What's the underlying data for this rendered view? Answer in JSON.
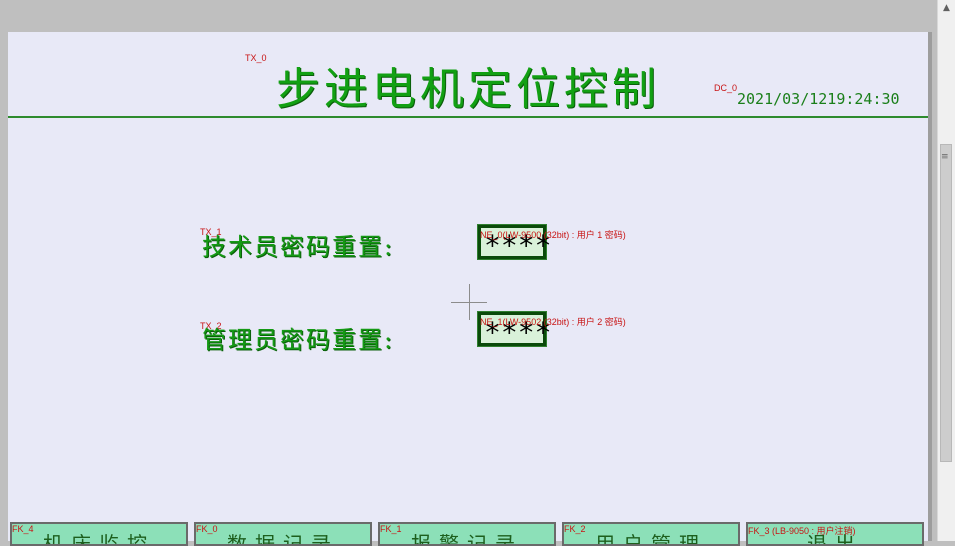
{
  "header": {
    "title": "步进电机定位控制",
    "title_tag": "TX_0",
    "datetime_tag": "DC_0",
    "datetime": "2021/03/1219:24:30"
  },
  "form": {
    "rows": [
      {
        "tag": "TX_1",
        "label": "技术员密码重置:",
        "field_tag": "NE_0(LW-9500 (32bit) : 用户 1 密码)",
        "masked_value": "****"
      },
      {
        "tag": "TX_2",
        "label": "管理员密码重置:",
        "field_tag": "NE_1(LW-9502 (32bit) : 用户 2 密码)",
        "masked_value": "****"
      }
    ]
  },
  "function_keys": [
    {
      "tag": "FK_4",
      "label": "机床监控"
    },
    {
      "tag": "FK_0",
      "label": "数据记录"
    },
    {
      "tag": "FK_1",
      "label": "报警记录"
    },
    {
      "tag": "FK_2",
      "label": "用户管理"
    },
    {
      "tag": "FK_3 (LB-9050 : 用户注销)",
      "label": "退出"
    }
  ],
  "colors": {
    "canvas": "#e8e9f7",
    "accent_green": "#12a013",
    "tag_red": "#c81414",
    "key_bg": "#8ce0b8"
  }
}
